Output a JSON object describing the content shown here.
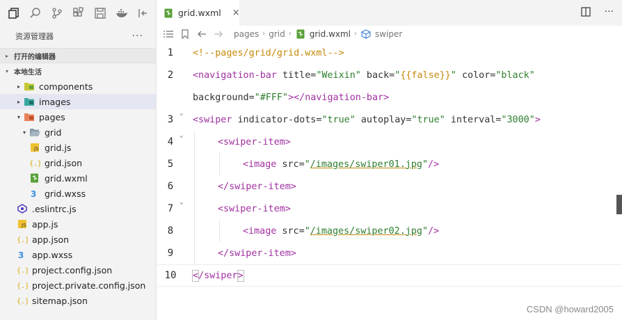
{
  "sidebar": {
    "explorer_title": "资源管理器",
    "more": "···",
    "open_editors": "打开的编辑器",
    "workspace": "本地生活",
    "tree": [
      {
        "label": "components",
        "depth": 1,
        "chev": "▸",
        "icon": "folder-components-icon"
      },
      {
        "label": "images",
        "depth": 1,
        "chev": "▸",
        "icon": "folder-images-icon"
      },
      {
        "label": "pages",
        "depth": 1,
        "chev": "▾",
        "icon": "folder-pages-icon"
      },
      {
        "label": "grid",
        "depth": 2,
        "chev": "▾",
        "icon": "folder-open-icon"
      },
      {
        "label": "grid.js",
        "depth": 3,
        "chev": "",
        "icon": "js-file-icon"
      },
      {
        "label": "grid.json",
        "depth": 3,
        "chev": "",
        "icon": "json-file-icon"
      },
      {
        "label": "grid.wxml",
        "depth": 3,
        "chev": "",
        "icon": "wxml-file-icon"
      },
      {
        "label": "grid.wxss",
        "depth": 3,
        "chev": "",
        "icon": "wxss-file-icon"
      },
      {
        "label": ".eslintrc.js",
        "depth": 1,
        "chev": "",
        "icon": "eslint-file-icon"
      },
      {
        "label": "app.js",
        "depth": 1,
        "chev": "",
        "icon": "js-file-icon"
      },
      {
        "label": "app.json",
        "depth": 1,
        "chev": "",
        "icon": "json-file-icon"
      },
      {
        "label": "app.wxss",
        "depth": 1,
        "chev": "",
        "icon": "wxss-file-icon"
      },
      {
        "label": "project.config.json",
        "depth": 1,
        "chev": "",
        "icon": "json-file-icon"
      },
      {
        "label": "project.private.config.json",
        "depth": 1,
        "chev": "",
        "icon": "json-file-icon"
      },
      {
        "label": "sitemap.json",
        "depth": 1,
        "chev": "",
        "icon": "json-file-icon"
      }
    ],
    "selected_index": 1
  },
  "editor": {
    "tab_label": "grid.wxml",
    "tab_close": "×",
    "breadcrumbs": [
      "pages",
      "grid",
      "grid.wxml",
      "swiper"
    ],
    "bc_sep": "›",
    "lines": [
      {
        "n": "1",
        "fold": "",
        "depth": 0,
        "tokens": [
          [
            "c-comment",
            "<!--pages/grid/grid.wxml-->"
          ]
        ]
      },
      {
        "n": "2",
        "fold": "",
        "depth": 0,
        "tokens": [
          [
            "c-tag",
            "<navigation-bar"
          ],
          [
            "c-attr",
            " title="
          ],
          [
            "c-str",
            "\"Weixin\""
          ],
          [
            "c-attr",
            " back="
          ],
          [
            "c-str",
            "\""
          ],
          [
            "c-brace",
            "{{false}}"
          ],
          [
            "c-str",
            "\""
          ],
          [
            "c-attr",
            " color="
          ],
          [
            "c-str",
            "\"black\""
          ]
        ]
      },
      {
        "n": "",
        "fold": "",
        "depth": 0,
        "tokens": [
          [
            "c-attr",
            "background="
          ],
          [
            "c-str",
            "\"#FFF\""
          ],
          [
            "c-tag",
            "></navigation-bar>"
          ]
        ]
      },
      {
        "n": "3",
        "fold": "⌄",
        "depth": 0,
        "tokens": [
          [
            "c-tag",
            "<swiper"
          ],
          [
            "c-attr",
            " indicator-dots="
          ],
          [
            "c-str",
            "\"true\""
          ],
          [
            "c-attr",
            " autoplay="
          ],
          [
            "c-str",
            "\"true\""
          ],
          [
            "c-attr",
            " interval="
          ],
          [
            "c-str",
            "\"3000\""
          ],
          [
            "c-tag",
            ">"
          ]
        ]
      },
      {
        "n": "4",
        "fold": "⌄",
        "depth": 1,
        "tokens": [
          [
            "c-tag",
            "<swiper-item>"
          ]
        ]
      },
      {
        "n": "5",
        "fold": "",
        "depth": 2,
        "tokens": [
          [
            "c-tag",
            "<image"
          ],
          [
            "c-attr",
            " src="
          ],
          [
            "c-str",
            "\""
          ],
          [
            "c-url",
            "/images/swiper01.jpg"
          ],
          [
            "c-str",
            "\""
          ],
          [
            "c-tag",
            "/>"
          ]
        ]
      },
      {
        "n": "6",
        "fold": "",
        "depth": 1,
        "tokens": [
          [
            "c-tag",
            "</swiper-item>"
          ]
        ]
      },
      {
        "n": "7",
        "fold": "⌄",
        "depth": 1,
        "tokens": [
          [
            "c-tag",
            "<swiper-item>"
          ]
        ]
      },
      {
        "n": "8",
        "fold": "",
        "depth": 2,
        "tokens": [
          [
            "c-tag",
            "<image"
          ],
          [
            "c-attr",
            " src="
          ],
          [
            "c-str",
            "\""
          ],
          [
            "c-url",
            "/images/swiper02.jpg"
          ],
          [
            "c-str",
            "\""
          ],
          [
            "c-tag",
            "/>"
          ]
        ]
      },
      {
        "n": "9",
        "fold": "",
        "depth": 1,
        "tokens": [
          [
            "c-tag",
            "</swiper-item>"
          ]
        ]
      },
      {
        "n": "10",
        "fold": "",
        "depth": 0,
        "current": true,
        "tokens": [
          [
            "c-tag bracket-box",
            "<"
          ],
          [
            "c-tag",
            "/swiper"
          ],
          [
            "c-tag bracket-box",
            ">"
          ]
        ]
      }
    ]
  },
  "watermark": "CSDN @howard2005"
}
